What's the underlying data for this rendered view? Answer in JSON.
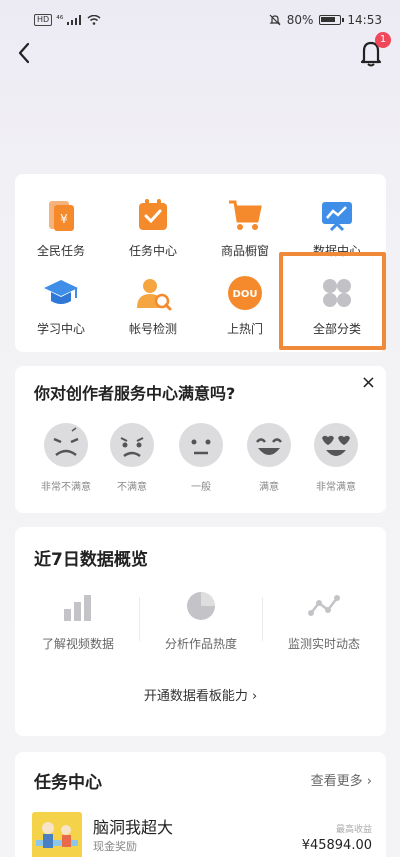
{
  "status_bar": {
    "left": "HD ⁴⁶",
    "battery": "80%",
    "time": "14:53"
  },
  "nav": {
    "notification_count": "1"
  },
  "grid": [
    {
      "label": "全民任务",
      "icon": "coins-card-icon"
    },
    {
      "label": "任务中心",
      "icon": "checklist-icon"
    },
    {
      "label": "商品橱窗",
      "icon": "shopping-cart-icon"
    },
    {
      "label": "数据中心",
      "icon": "chart-board-icon"
    },
    {
      "label": "学习中心",
      "icon": "graduation-cap-icon"
    },
    {
      "label": "帐号检测",
      "icon": "account-check-icon"
    },
    {
      "label": "上热门",
      "icon": "dou-plus-icon"
    },
    {
      "label": "全部分类",
      "icon": "four-dots-icon"
    }
  ],
  "survey": {
    "title": "你对创作者服务中心满意吗?",
    "close": "×",
    "options": [
      "非常不满意",
      "不满意",
      "一般",
      "满意",
      "非常满意"
    ]
  },
  "data_overview": {
    "title": "近7日数据概览",
    "items": [
      "了解视频数据",
      "分析作品热度",
      "监测实时动态"
    ],
    "link": "开通数据看板能力 ›"
  },
  "task_center": {
    "title": "任务中心",
    "more": "查看更多 ›",
    "task": {
      "name": "脑洞我超大",
      "sub": "现金奖励",
      "max_label": "最高收益",
      "value": "¥45894.00"
    }
  },
  "colors": {
    "accent_orange": "#f58a2c",
    "highlight_border": "#ef8a3a",
    "badge_red": "#f0475a",
    "icon_blue": "#3f8fe8"
  }
}
